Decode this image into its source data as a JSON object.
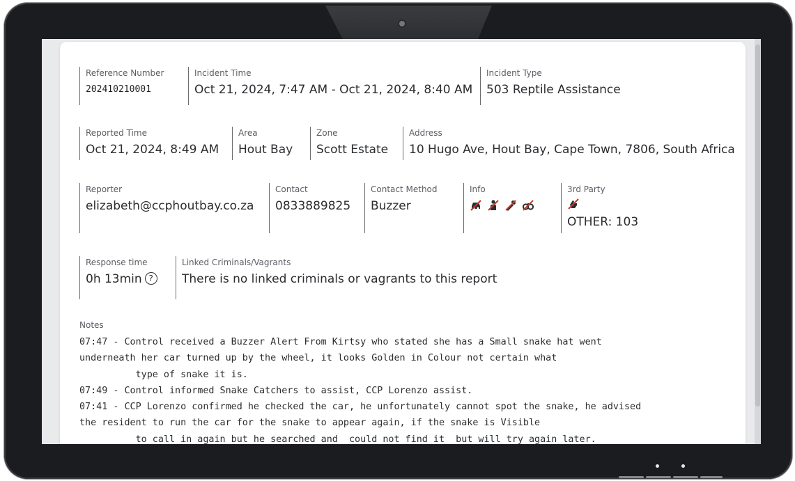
{
  "incident": {
    "reference_number": {
      "label": "Reference Number",
      "value": "202410210001"
    },
    "incident_time": {
      "label": "Incident Time",
      "value": "Oct 21, 2024, 7:47 AM - Oct 21, 2024, 8:40 AM"
    },
    "incident_type": {
      "label": "Incident Type",
      "value": "503 Reptile Assistance"
    },
    "reported_time": {
      "label": "Reported Time",
      "value": "Oct 21, 2024, 8:49 AM"
    },
    "area": {
      "label": "Area",
      "value": "Hout Bay"
    },
    "zone": {
      "label": "Zone",
      "value": "Scott Estate"
    },
    "address": {
      "label": "Address",
      "value": "10 Hugo Ave, Hout Bay, Cape Town, 7806, South Africa"
    },
    "reporter": {
      "label": "Reporter",
      "value": "elizabeth@ccphoutbay.co.za"
    },
    "contact": {
      "label": "Contact",
      "value": "0833889825"
    },
    "contact_method": {
      "label": "Contact Method",
      "value": "Buzzer"
    },
    "info": {
      "label": "Info",
      "icons": [
        "vehicle-crossed-icon",
        "person-crossed-icon",
        "weapon-crossed-icon",
        "handcuffs-crossed-icon"
      ]
    },
    "third_party": {
      "label": "3rd Party",
      "icon": "hand-crossed-icon",
      "value": "OTHER: 103"
    },
    "response_time": {
      "label": "Response time",
      "value": "0h 13min",
      "help_icon": "?"
    },
    "linked": {
      "label": "Linked Criminals/Vagrants",
      "value": "There is no linked criminals or vagrants to this report"
    },
    "notes": {
      "label": "Notes",
      "text": "07:47 - Control received a Buzzer Alert From Kirtsy who stated she has a Small snake hat went\nunderneath her car turned up by the wheel, it looks Golden in Colour not certain what\n          type of snake it is.\n07:49 - Control informed Snake Catchers to assist, CCP Lorenzo assist.\n07:41 - CCP Lorenzo confirmed he checked the car, he unfortunately cannot spot the snake, he advised\nthe resident to run the car for the snake to appear again, if the snake is Visible\n          to call in again but he searched and  could not find it  but will try again later."
    }
  },
  "colors": {
    "icon_red": "#c0392b",
    "text": "#2b2d30",
    "label": "#5a5d63"
  }
}
